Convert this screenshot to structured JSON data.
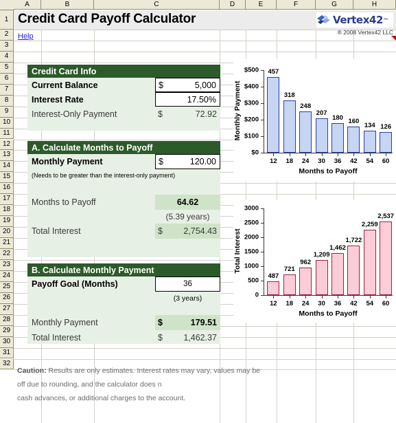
{
  "app": {
    "title": "Credit Card Payoff Calculator",
    "help_label": "Help",
    "brand_name": "Vertex42",
    "brand_tm": "™",
    "copyright": "® 2008 Vertex42 LLC"
  },
  "grid": {
    "columns": [
      "A",
      "B",
      "C",
      "D",
      "E",
      "F",
      "G",
      "H"
    ],
    "rows": [
      "1",
      "2",
      "3",
      "4",
      "5",
      "6",
      "7",
      "8",
      "9",
      "10",
      "11",
      "12",
      "13",
      "14",
      "15",
      "16",
      "17",
      "18",
      "19",
      "20",
      "21",
      "22",
      "23",
      "24",
      "25",
      "26",
      "27",
      "28",
      "29",
      "30",
      "31",
      "32"
    ]
  },
  "colors": {
    "header_green": "#2d5a2b",
    "panel_green": "#e7f0e4",
    "highlight_green": "#cfe3c8",
    "bar_blue_fill": "#c5d5f2",
    "bar_blue_border": "#2a3f9e",
    "bar_pink_fill": "#fbcdd8",
    "bar_pink_border": "#9b2141",
    "link_blue": "#2222cc",
    "brand_blue": "#2b3f8c"
  },
  "card_info": {
    "heading": "Credit Card Info",
    "balance_label": "Current Balance",
    "balance_currency": "$",
    "balance_value": "5,000",
    "rate_label": "Interest Rate",
    "rate_value": "17.50%",
    "interest_only_label": "Interest-Only Payment",
    "interest_only_currency": "$",
    "interest_only_value": "72.92"
  },
  "section_a": {
    "heading": "A.  Calculate Months to Payoff",
    "payment_label": "Monthly Payment",
    "payment_currency": "$",
    "payment_value": "120.00",
    "payment_note": "(Needs to be greater than the interest-only payment)",
    "months_label": "Months to Payoff",
    "months_value": "64.62",
    "years_value": "(5.39 years)",
    "total_interest_label": "Total Interest",
    "total_interest_currency": "$",
    "total_interest_value": "2,754.43"
  },
  "section_b": {
    "heading": "B.  Calculate Monthly Payment",
    "goal_label": "Payoff Goal (Months)",
    "goal_value": "36",
    "goal_years": "(3 years)",
    "payment_label": "Monthly Payment",
    "payment_currency": "$",
    "payment_value": "179.51",
    "total_interest_label": "Total Interest",
    "total_interest_currency": "$",
    "total_interest_value": "1,462.37"
  },
  "caution": {
    "prefix": "Caution:",
    "line1": " Results are only estimates. Interest rates may vary, values may be",
    "line2": "off due to rounding, and the calculator does n",
    "line3": "cash advances, or additional charges to the account."
  },
  "chart_data": [
    {
      "id": "monthly-payment-chart",
      "type": "bar",
      "title": "",
      "xlabel": "Months to Payoff",
      "ylabel": "Monthly Payment",
      "categories": [
        "12",
        "18",
        "24",
        "30",
        "36",
        "42",
        "54",
        "60"
      ],
      "values": [
        457,
        318,
        248,
        207,
        180,
        160,
        134,
        126
      ],
      "data_labels": [
        "457",
        "318",
        "248",
        "207",
        "180",
        "160",
        "134",
        "126"
      ],
      "ytick_labels": [
        "$0",
        "$100",
        "$200",
        "$300",
        "$400",
        "$500"
      ],
      "yticks": [
        0,
        100,
        200,
        300,
        400,
        500
      ],
      "ylim": [
        0,
        500
      ],
      "grid": false,
      "legend": false,
      "fill": "#c5d5f2",
      "border": "#2a3f9e"
    },
    {
      "id": "total-interest-chart",
      "type": "bar",
      "title": "",
      "xlabel": "Months to Payoff",
      "ylabel": "Total Interest",
      "categories": [
        "12",
        "18",
        "24",
        "30",
        "36",
        "42",
        "54",
        "60"
      ],
      "values": [
        487,
        721,
        962,
        1209,
        1462,
        1722,
        2259,
        2537
      ],
      "data_labels": [
        "487",
        "721",
        "962",
        "1,209",
        "1,462",
        "1,722",
        "2,259",
        "2,537"
      ],
      "ytick_labels": [
        "0",
        "500",
        "1000",
        "1500",
        "2000",
        "2500",
        "3000"
      ],
      "yticks": [
        0,
        500,
        1000,
        1500,
        2000,
        2500,
        3000
      ],
      "ylim": [
        0,
        3000
      ],
      "grid": false,
      "legend": false,
      "fill": "#fbcdd8",
      "border": "#9b2141"
    }
  ]
}
